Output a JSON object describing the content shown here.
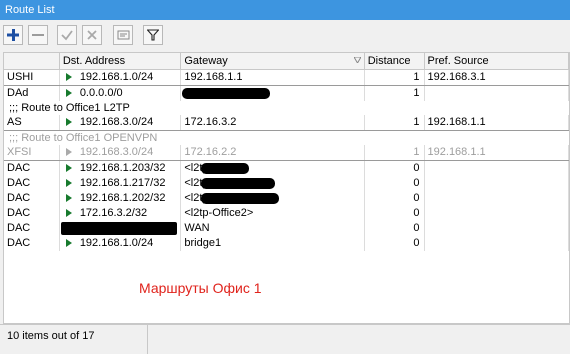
{
  "window": {
    "title": "Route List"
  },
  "toolbar": {
    "buttons": [
      "add-icon",
      "remove-icon",
      "enable-check-icon",
      "disable-x-icon",
      "comment-icon",
      "filter-icon"
    ]
  },
  "table": {
    "headers": [
      "",
      "Dst. Address",
      "Gateway",
      "Distance",
      "Pref. Source"
    ],
    "rows": [
      {
        "flags": "USHI",
        "dst": "192.168.1.0/24",
        "gw": "192.168.1.1",
        "dist": "1",
        "src": "192.168.3.1"
      },
      {
        "flags": "DAd",
        "dst": "0.0.0.0/0",
        "gw": "",
        "dist": "1",
        "src": ""
      },
      {
        "comment": ";;; Route to Office1 L2TP"
      },
      {
        "flags": "AS",
        "dst": "192.168.3.0/24",
        "gw": "172.16.3.2",
        "dist": "1",
        "src": "192.168.1.1"
      },
      {
        "comment": ";;; Route to Office1 OPENVPN",
        "disabled": true
      },
      {
        "flags": "XFSI",
        "dst": "192.168.3.0/24",
        "gw": "172.16.2.2",
        "dist": "1",
        "src": "192.168.1.1",
        "disabled": true
      },
      {
        "flags": "DAC",
        "dst": "192.168.1.203/32",
        "gw": "<l2tp",
        "dist": "0",
        "src": ""
      },
      {
        "flags": "DAC",
        "dst": "192.168.1.217/32",
        "gw": "<l2tp",
        "dist": "0",
        "src": ""
      },
      {
        "flags": "DAC",
        "dst": "192.168.1.202/32",
        "gw": "<l2tp",
        "dist": "0",
        "src": ""
      },
      {
        "flags": "DAC",
        "dst": "172.16.3.2/32",
        "gw": "<l2tp-Office2>",
        "dist": "0",
        "src": ""
      },
      {
        "flags": "DAC",
        "dst": "",
        "gw": "WAN",
        "dist": "0",
        "src": ""
      },
      {
        "flags": "DAC",
        "dst": "192.168.1.0/24",
        "gw": "bridge1",
        "dist": "0",
        "src": ""
      }
    ]
  },
  "annotation": "Маршруты Офис 1",
  "status": {
    "text": "10 items out of 17"
  },
  "colors": {
    "titlebar": "#3d95e0",
    "annotation": "#e0231c",
    "active_arrow": "#177a2d"
  }
}
